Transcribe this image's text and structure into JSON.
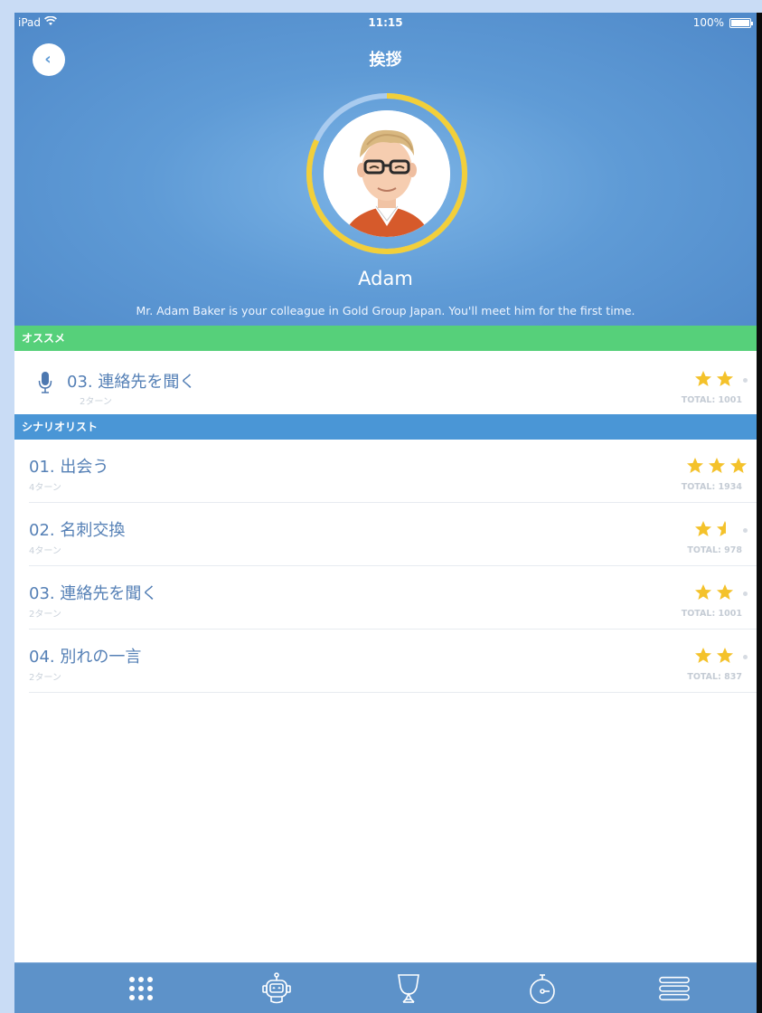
{
  "status": {
    "device": "iPad",
    "time": "11:15",
    "battery": "100%",
    "battery_level": 1.0
  },
  "header": {
    "title": "挨拶",
    "character_name": "Adam",
    "description": "Mr. Adam Baker is your colleague in Gold Group Japan. You'll meet him for the first time.",
    "progress": 0.82
  },
  "recommended": {
    "section_label": "オススメ",
    "item": {
      "title": "03. 連絡先を聞く",
      "turns": "2ターン",
      "stars": 2,
      "max_stars": 3,
      "total": "TOTAL: 1001"
    }
  },
  "scenario_list": {
    "section_label": "シナリオリスト",
    "items": [
      {
        "title": "01. 出会う",
        "turns": "4ターン",
        "stars": 3,
        "max_stars": 3,
        "total": "TOTAL: 1934"
      },
      {
        "title": "02. 名刺交換",
        "turns": "4ターン",
        "stars": 1.5,
        "max_stars": 3,
        "total": "TOTAL: 978"
      },
      {
        "title": "03. 連絡先を聞く",
        "turns": "2ターン",
        "stars": 2,
        "max_stars": 3,
        "total": "TOTAL: 1001"
      },
      {
        "title": "04. 別れの一言",
        "turns": "2ターン",
        "stars": 2,
        "max_stars": 3,
        "total": "TOTAL: 837"
      }
    ]
  },
  "tabbar": {
    "tabs": [
      {
        "icon": "grid-icon"
      },
      {
        "icon": "robot-icon"
      },
      {
        "icon": "trophy-icon"
      },
      {
        "icon": "stopwatch-icon"
      },
      {
        "icon": "menu-icon"
      }
    ]
  },
  "colors": {
    "header_blue": "#5f9bd6",
    "recommend_green": "#56d07a",
    "section_blue": "#4a96d6",
    "star_gold": "#f4c22b",
    "tabbar": "#5d92c9"
  }
}
